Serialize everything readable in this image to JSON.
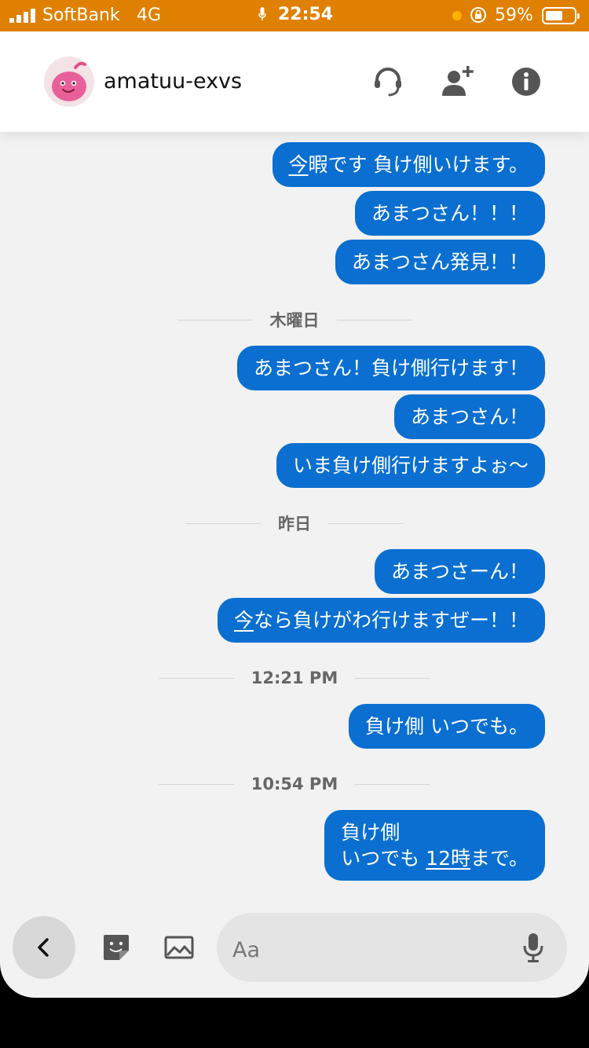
{
  "status_bar": {
    "carrier": "SoftBank",
    "network": "4G",
    "time": "22:54",
    "battery_percent": "59%",
    "battery_level": 0.59,
    "background_color": "#e08000"
  },
  "header": {
    "contact_name": "amatuu-exvs",
    "icons": [
      "headset-icon",
      "add-user-icon",
      "info-icon"
    ]
  },
  "messages": [
    {
      "type": "bubble",
      "parts": [
        {
          "text": "今",
          "underline": true
        },
        {
          "text": "暇です 負け側いけます。"
        }
      ]
    },
    {
      "type": "bubble",
      "parts": [
        {
          "text": "あまつさん！！！"
        }
      ]
    },
    {
      "type": "bubble",
      "parts": [
        {
          "text": "あまつさん発見！！"
        }
      ]
    },
    {
      "type": "separator",
      "label": "木曜日"
    },
    {
      "type": "bubble",
      "parts": [
        {
          "text": "あまつさん！負け側行けます！"
        }
      ]
    },
    {
      "type": "bubble",
      "parts": [
        {
          "text": "あまつさん！"
        }
      ]
    },
    {
      "type": "bubble",
      "parts": [
        {
          "text": "いま負け側行けますよぉ〜"
        }
      ]
    },
    {
      "type": "separator",
      "label": "昨日"
    },
    {
      "type": "bubble",
      "parts": [
        {
          "text": "あまつさーん！"
        }
      ]
    },
    {
      "type": "bubble",
      "parts": [
        {
          "text": "今",
          "underline": true
        },
        {
          "text": "なら負けがわ行けますぜー！！"
        }
      ]
    },
    {
      "type": "separator",
      "label": "12:21 PM"
    },
    {
      "type": "bubble",
      "parts": [
        {
          "text": "負け側 いつでも。"
        }
      ]
    },
    {
      "type": "separator",
      "label": "10:54 PM"
    },
    {
      "type": "bubble",
      "lines": [
        [
          {
            "text": "負け側"
          }
        ],
        [
          {
            "text": "いつでも "
          },
          {
            "text": "12時",
            "underline": true
          },
          {
            "text": "まで。"
          }
        ]
      ]
    }
  ],
  "composer": {
    "placeholder": "Aa",
    "icons": [
      "back-chevron-icon",
      "sticker-icon",
      "image-icon",
      "microphone-icon"
    ]
  },
  "colors": {
    "bubble": "#0a6fd0",
    "background": "#f2f2f2",
    "accent_orange": "#e08000"
  }
}
